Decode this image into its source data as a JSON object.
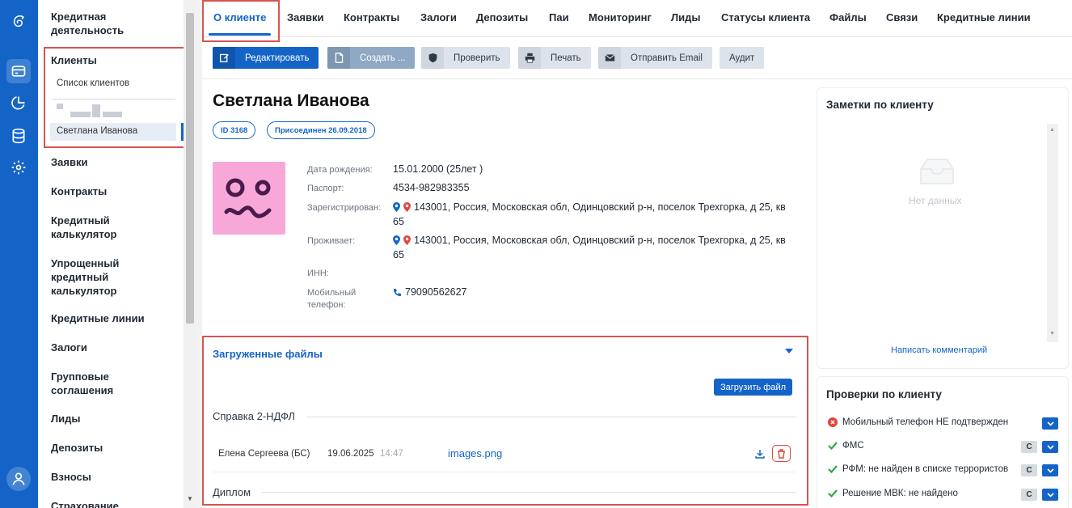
{
  "sidebar": {
    "section_title": "Кредитная деятельность",
    "clients": "Клиенты",
    "clients_list": "Список клиентов",
    "current_client": "Светлана Иванова",
    "items": [
      "Заявки",
      "Контракты",
      "Кредитный калькулятор",
      "Упрощенный кредитный калькулятор",
      "Кредитные линии",
      "Залоги",
      "Групповые соглашения",
      "Лиды",
      "Депозиты",
      "Взносы",
      "Страхование"
    ]
  },
  "rail": {
    "icons": [
      "logo-icon",
      "card-icon",
      "pie-chart-icon",
      "database-icon",
      "gear-icon",
      "user-icon"
    ]
  },
  "tabs": [
    "О клиенте",
    "Заявки",
    "Контракты",
    "Залоги",
    "Депозиты",
    "Паи",
    "Мониторинг",
    "Лиды",
    "Статусы клиента",
    "Файлы",
    "Связи",
    "Кредитные линии"
  ],
  "toolbar": {
    "edit": "Редактировать",
    "create": "Создать ...",
    "check": "Проверить",
    "print": "Печать",
    "email": "Отправить Email",
    "audit": "Аудит"
  },
  "client": {
    "name": "Светлана Иванова",
    "id_badge": "ID 3168",
    "joined_badge": "Присоединен 26.09.2018",
    "birth_label": "Дата рождения:",
    "birth_value": "15.01.2000 (25лет )",
    "passport_label": "Паспорт:",
    "passport_value": "4534-982983355",
    "registered_label": "Зарегистрирован:",
    "registered_value": "143001, Россия, Московская обл, Одинцовский р-н, поселок Трехгорка, д 25, кв 65",
    "lives_label": "Проживает:",
    "lives_value": "143001, Россия, Московская обл, Одинцовский р-н, поселок Трехгорка, д 25, кв 65",
    "inn_label": "ИНН:",
    "inn_value": "",
    "phone_label": "Мобильный телефон:",
    "phone_value": "79090562627"
  },
  "files": {
    "title": "Загруженные файлы",
    "upload": "Загрузить файл",
    "section1": "Справка 2-НДФЛ",
    "row": {
      "author": "Елена Сергеева (БС)",
      "date": "19.06.2025",
      "time": "14:47",
      "file": "images.png"
    },
    "section2": "Диплом"
  },
  "notes": {
    "title": "Заметки по клиенту",
    "empty": "Нет данных",
    "write": "Написать комментарий"
  },
  "checks": {
    "title": "Проверки по клиенту",
    "items": [
      {
        "label": "Мобильный телефон НЕ подтвержден",
        "status": "fail"
      },
      {
        "label": "ФМС",
        "status": "ok"
      },
      {
        "label": "РФМ: не найден в списке террористов",
        "status": "ok"
      },
      {
        "label": "Решение МВК: не найдено",
        "status": "ok"
      }
    ],
    "refresh_glyph": "C"
  },
  "colors": {
    "primary": "#1464c8",
    "avatar_bg": "#f7a8d8",
    "highlight": "#d9534f",
    "ok": "#2eaa3f",
    "fail": "#e0463c"
  }
}
